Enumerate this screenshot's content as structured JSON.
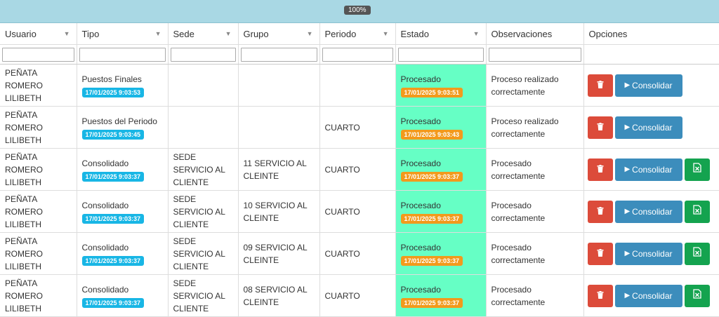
{
  "zoom": "100%",
  "columns": [
    "Usuario",
    "Tipo",
    "Sede",
    "Grupo",
    "Periodo",
    "Estado",
    "Observaciones",
    "Opciones"
  ],
  "icons": {
    "trash": "trash-icon",
    "play": "play-icon",
    "excel": "excel-file-icon",
    "filter": "filter-icon"
  },
  "colors": {
    "estado_bg": "#66ffc5",
    "badge_tipo": "#18b6e5",
    "badge_estado": "#f29a1c",
    "delete": "#dc4b3a",
    "consolidar": "#3c8dbc",
    "excel": "#14a34f",
    "topbar": "#a9d8e4"
  },
  "consolidar_label": "Consolidar",
  "rows": [
    {
      "usuario": "PEÑATA ROMERO LILIBETH",
      "tipo": "Puestos Finales",
      "tipo_fecha": "17/01/2025 9:03:53",
      "sede": "",
      "grupo": "",
      "periodo": "",
      "estado": "Procesado",
      "estado_fecha": "17/01/2025 9:03:51",
      "obs": "Proceso realizado correctamente",
      "excel": false
    },
    {
      "usuario": "PEÑATA ROMERO LILIBETH",
      "tipo": "Puestos del Periodo",
      "tipo_fecha": "17/01/2025 9:03:45",
      "sede": "",
      "grupo": "",
      "periodo": "CUARTO",
      "estado": "Procesado",
      "estado_fecha": "17/01/2025 9:03:43",
      "obs": "Proceso realizado correctamente",
      "excel": false
    },
    {
      "usuario": "PEÑATA ROMERO LILIBETH",
      "tipo": "Consolidado",
      "tipo_fecha": "17/01/2025 9:03:37",
      "sede": "SEDE SERVICIO AL CLIENTE",
      "grupo": "11 SERVICIO AL CLEINTE",
      "periodo": "CUARTO",
      "estado": "Procesado",
      "estado_fecha": "17/01/2025 9:03:37",
      "obs": "Procesado correctamente",
      "excel": true
    },
    {
      "usuario": "PEÑATA ROMERO LILIBETH",
      "tipo": "Consolidado",
      "tipo_fecha": "17/01/2025 9:03:37",
      "sede": "SEDE SERVICIO AL CLIENTE",
      "grupo": "10 SERVICIO AL CLEINTE",
      "periodo": "CUARTO",
      "estado": "Procesado",
      "estado_fecha": "17/01/2025 9:03:37",
      "obs": "Procesado correctamente",
      "excel": true
    },
    {
      "usuario": "PEÑATA ROMERO LILIBETH",
      "tipo": "Consolidado",
      "tipo_fecha": "17/01/2025 9:03:37",
      "sede": "SEDE SERVICIO AL CLIENTE",
      "grupo": "09 SERVICIO AL CLEINTE",
      "periodo": "CUARTO",
      "estado": "Procesado",
      "estado_fecha": "17/01/2025 9:03:37",
      "obs": "Procesado correctamente",
      "excel": true
    },
    {
      "usuario": "PEÑATA ROMERO LILIBETH",
      "tipo": "Consolidado",
      "tipo_fecha": "17/01/2025 9:03:37",
      "sede": "SEDE SERVICIO AL CLIENTE",
      "grupo": "08 SERVICIO AL CLEINTE",
      "periodo": "CUARTO",
      "estado": "Procesado",
      "estado_fecha": "17/01/2025 9:03:37",
      "obs": "Procesado correctamente",
      "excel": true
    }
  ]
}
